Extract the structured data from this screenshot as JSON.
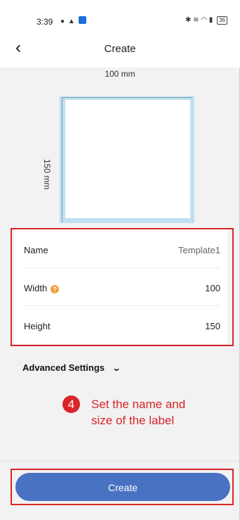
{
  "status_bar": {
    "time": "3:39",
    "left_icons": [
      "message-icon",
      "notification-icon",
      "app-icon"
    ],
    "right_icons": [
      "bluetooth-icon",
      "vibrate-icon",
      "wifi-icon",
      "signal-icon"
    ],
    "battery": "36"
  },
  "header": {
    "title": "Create",
    "back_icon": "chevron-left-icon"
  },
  "preview": {
    "width_label": "100 mm",
    "height_label": "150 mm"
  },
  "form": {
    "name_label": "Name",
    "name_value": "Template1",
    "width_label": "Width",
    "width_value": "100",
    "width_info_icon": "question-icon",
    "height_label": "Height",
    "height_value": "150"
  },
  "advanced": {
    "label": "Advanced Settings",
    "icon": "chevron-down-icon"
  },
  "annotation": {
    "step": "4",
    "text_line1": "Set the name and",
    "text_line2": "size of the label",
    "color": "#d9252a"
  },
  "footer": {
    "create_label": "Create",
    "button_color": "#4a72c2"
  }
}
